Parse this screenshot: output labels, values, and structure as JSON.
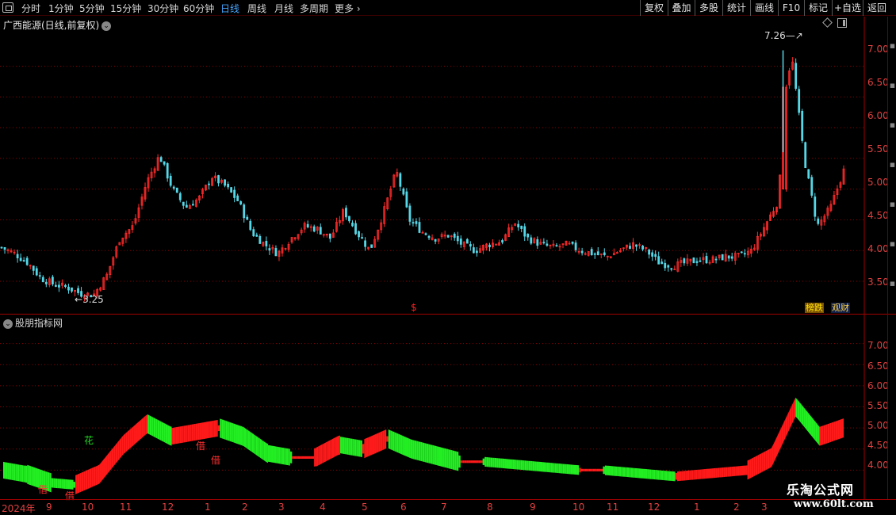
{
  "toolbar": {
    "periods": [
      "分时",
      "1分钟",
      "5分钟",
      "15分钟",
      "30分钟",
      "60分钟",
      "日线",
      "周线",
      "月线",
      "多周期",
      "更多"
    ],
    "active_period": "日线",
    "right_buttons": [
      "复权",
      "叠加",
      "多股",
      "统计",
      "画线",
      "F10",
      "标记",
      "+自选",
      "返回"
    ]
  },
  "main_chart": {
    "title": "广西能源(日线,前复权)",
    "y_ticks": [
      "7.00",
      "6.50",
      "6.00",
      "5.50",
      "5.00",
      "4.50",
      "4.00",
      "3.50"
    ],
    "peak_label": "7.26",
    "low_label": "3.25",
    "dollar_mark": "$",
    "badge_bang": "榜跌",
    "badge_ice": "观财"
  },
  "indicator": {
    "title": "股朋指标网",
    "y_ticks": [
      "7.00",
      "6.50",
      "6.00",
      "5.50",
      "5.00",
      "4.50",
      "4.00"
    ],
    "signals": [
      {
        "text": "花",
        "color": "#22dd22"
      },
      {
        "text": "借",
        "color": "#ff3030"
      },
      {
        "text": "借",
        "color": "#ff3030"
      },
      {
        "text": "借",
        "color": "#ff3030"
      },
      {
        "text": "借",
        "color": "#ff3030"
      }
    ]
  },
  "time_axis": {
    "labels": [
      "2024年",
      "9",
      "10",
      "11",
      "12",
      "1",
      "2",
      "3",
      "4",
      "5",
      "6",
      "7",
      "8",
      "9",
      "10",
      "11",
      "12",
      "1",
      "2",
      "3"
    ]
  },
  "watermark": {
    "text": "乐淘公式网",
    "url": "www.60lt.com"
  },
  "colors": {
    "up": "#ff2a2a",
    "down": "#55d8e8",
    "band_up": "#ff1a1a",
    "band_down": "#22ee22",
    "grid": "#8a0000"
  },
  "chart_data": {
    "type": "candlestick",
    "price_min": 3.25,
    "price_max": 7.26,
    "ylim": [
      3.1,
      7.55
    ],
    "close_path": [
      4.05,
      3.95,
      3.8,
      3.55,
      3.45,
      3.4,
      3.3,
      3.28,
      3.6,
      4.2,
      4.4,
      5.1,
      5.55,
      5.0,
      4.7,
      4.85,
      5.2,
      5.05,
      4.8,
      4.3,
      4.1,
      3.95,
      4.2,
      4.4,
      4.35,
      4.2,
      4.65,
      4.3,
      4.0,
      4.6,
      5.3,
      4.5,
      4.3,
      4.2,
      4.25,
      4.1,
      4.0,
      4.1,
      4.15,
      4.45,
      4.2,
      4.1,
      4.05,
      4.1,
      4.0,
      3.95,
      3.9,
      4.0,
      4.1,
      4.0,
      3.8,
      3.75,
      3.8,
      3.85,
      3.85,
      3.9,
      3.9,
      4.0,
      4.4,
      4.8,
      7.26,
      5.5,
      4.4,
      4.7,
      5.3
    ],
    "indicator_ylim": [
      3.5,
      7.5
    ],
    "indicator_path": [
      4.0,
      3.9,
      3.7,
      3.65,
      3.9,
      4.6,
      5.1,
      4.8,
      4.9,
      5.0,
      4.8,
      4.4,
      4.3,
      4.3,
      4.6,
      4.5,
      4.75,
      4.5,
      4.35,
      4.2,
      4.2,
      4.15,
      4.1,
      4.05,
      4.0,
      4.0,
      3.95,
      3.9,
      3.85,
      3.9,
      3.95,
      4.0,
      4.3,
      5.5,
      4.8,
      5.0
    ]
  }
}
